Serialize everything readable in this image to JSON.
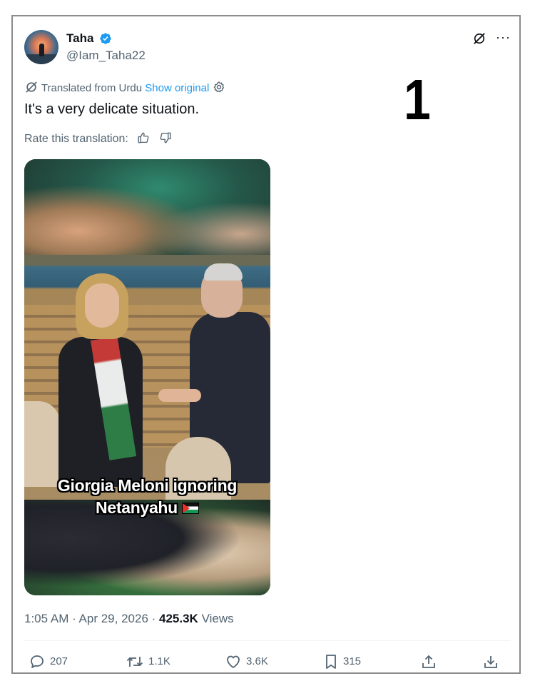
{
  "author": {
    "name": "Taha",
    "handle": "@Iam_Taha22"
  },
  "header": {
    "more_label": "···"
  },
  "overlay_label": "1",
  "translation": {
    "note": "Translated from Urdu",
    "show_original": "Show original"
  },
  "tweet_text": "It's a very delicate situation.",
  "rate": {
    "label": "Rate this translation:"
  },
  "media": {
    "caption_line1": "Giorgia Meloni ignoring",
    "caption_line2": "Netanyahu"
  },
  "meta": {
    "time": "1:05 AM",
    "sep1": " · ",
    "date": "Apr 29, 2026",
    "sep2": " · ",
    "views_count": "425.3K",
    "views_label": " Views"
  },
  "actions": {
    "replies": "207",
    "reposts": "1.1K",
    "likes": "3.6K",
    "bookmarks": "315"
  },
  "colors": {
    "accent": "#1d9bf0",
    "secondary_text": "#536471",
    "primary_text": "#0f1419"
  }
}
